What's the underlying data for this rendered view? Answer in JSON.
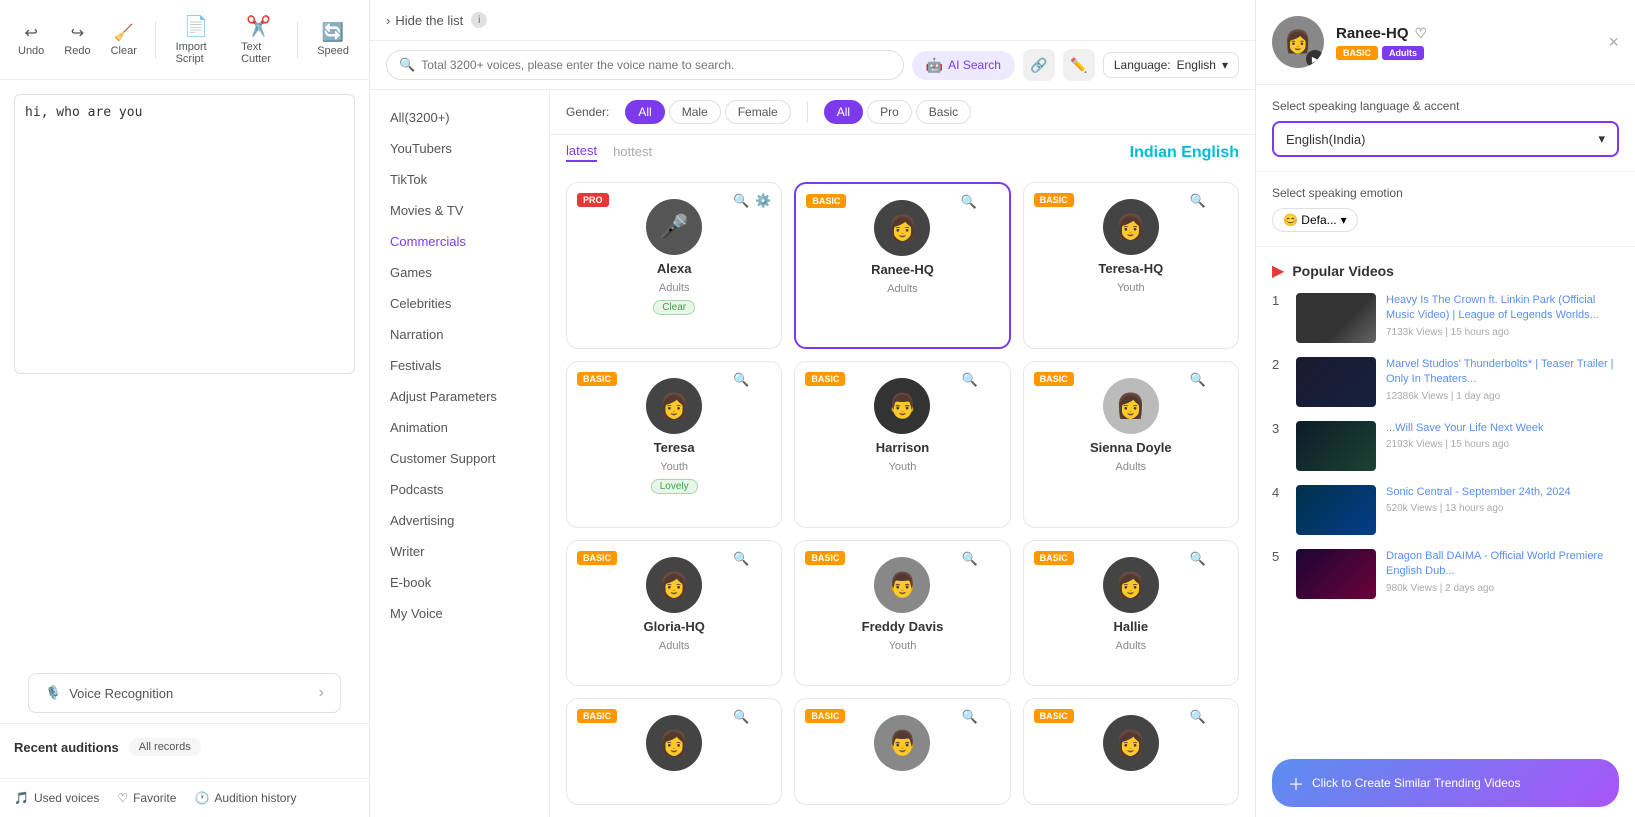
{
  "toolbar": {
    "undo_label": "Undo",
    "redo_label": "Redo",
    "clear_label": "Clear",
    "import_label": "Import Script",
    "text_cutter_label": "Text Cutter",
    "speed_label": "Speed"
  },
  "text_area": {
    "content": "hi, who are you"
  },
  "voice_recognition": {
    "label": "Voice Recognition"
  },
  "recent": {
    "title": "Recent auditions",
    "all_records": "All records"
  },
  "bottom_nav": {
    "used_voices": "Used voices",
    "favorite": "Favorite",
    "audition_history": "Audition history"
  },
  "center": {
    "hide_list": "Hide the list",
    "search_placeholder": "Total 3200+ voices, please enter the voice name to search.",
    "ai_search": "AI Search",
    "language_label": "Language:",
    "language_value": "English",
    "categories": [
      {
        "id": "all",
        "label": "All(3200+)"
      },
      {
        "id": "youtubers",
        "label": "YouTubers"
      },
      {
        "id": "tiktok",
        "label": "TikTok"
      },
      {
        "id": "movies-tv",
        "label": "Movies & TV"
      },
      {
        "id": "commercials",
        "label": "Commercials",
        "active": true
      },
      {
        "id": "games",
        "label": "Games"
      },
      {
        "id": "celebrities",
        "label": "Celebrities"
      },
      {
        "id": "narration",
        "label": "Narration"
      },
      {
        "id": "festivals",
        "label": "Festivals"
      },
      {
        "id": "adjust-params",
        "label": "Adjust Parameters"
      },
      {
        "id": "animation",
        "label": "Animation"
      },
      {
        "id": "customer-support",
        "label": "Customer Support"
      },
      {
        "id": "podcasts",
        "label": "Podcasts"
      },
      {
        "id": "advertising",
        "label": "Advertising"
      },
      {
        "id": "writer",
        "label": "Writer"
      },
      {
        "id": "e-book",
        "label": "E-book"
      },
      {
        "id": "my-voice",
        "label": "My Voice"
      }
    ],
    "gender_label": "Gender:",
    "gender_filters": [
      {
        "id": "all",
        "label": "All",
        "active": true
      },
      {
        "id": "male",
        "label": "Male"
      },
      {
        "id": "female",
        "label": "Female"
      }
    ],
    "quality_filters": [
      {
        "id": "all",
        "label": "All",
        "active": true
      },
      {
        "id": "pro",
        "label": "Pro"
      },
      {
        "id": "basic",
        "label": "Basic"
      }
    ],
    "tabs": [
      {
        "id": "latest",
        "label": "latest",
        "active": true
      },
      {
        "id": "hottest",
        "label": "hottest"
      }
    ],
    "region_title": "Indian English",
    "voices": [
      {
        "id": "alexa",
        "name": "Alexa",
        "type": "Adults",
        "badge": "PRO",
        "badge_type": "pro",
        "tag": "Clear",
        "avatar_class": "mic",
        "avatar_icon": "🎤"
      },
      {
        "id": "ranee-hq",
        "name": "Ranee-HQ",
        "type": "Adults",
        "badge": "BASIC",
        "badge_type": "basic",
        "selected": true,
        "avatar_class": "dark-female",
        "avatar_icon": "👩"
      },
      {
        "id": "teresa-hq",
        "name": "Teresa-HQ",
        "type": "Youth",
        "badge": "BASIC",
        "badge_type": "basic",
        "avatar_class": "dark-female",
        "avatar_icon": "👩"
      },
      {
        "id": "teresa",
        "name": "Teresa",
        "type": "Youth",
        "badge": "BASIC",
        "badge_type": "basic",
        "tag": "Lovely",
        "avatar_class": "dark-female",
        "avatar_icon": "👩"
      },
      {
        "id": "harrison",
        "name": "Harrison",
        "type": "Youth",
        "badge": "BASIC",
        "badge_type": "basic",
        "avatar_class": "dark",
        "avatar_icon": "👨"
      },
      {
        "id": "sienna-doyle",
        "name": "Sienna Doyle",
        "type": "Adults",
        "badge": "BASIC",
        "badge_type": "basic",
        "avatar_class": "gray",
        "avatar_icon": "👩"
      },
      {
        "id": "gloria-hq",
        "name": "Gloria-HQ",
        "type": "Adults",
        "badge": "BASIC",
        "badge_type": "basic",
        "avatar_class": "dark-female",
        "avatar_icon": "👩"
      },
      {
        "id": "freddy-davis",
        "name": "Freddy Davis",
        "type": "Youth",
        "badge": "BASIC",
        "badge_type": "basic",
        "avatar_class": "medium",
        "avatar_icon": "👨"
      },
      {
        "id": "hallie",
        "name": "Hallie",
        "type": "Adults",
        "badge": "BASIC",
        "badge_type": "basic",
        "avatar_class": "dark-female",
        "avatar_icon": "👩"
      },
      {
        "id": "voice-row4-1",
        "name": "",
        "type": "",
        "badge": "BASIC",
        "badge_type": "basic",
        "avatar_class": "dark-female",
        "avatar_icon": "👩"
      },
      {
        "id": "voice-row4-2",
        "name": "",
        "type": "",
        "badge": "BASIC",
        "badge_type": "basic",
        "avatar_class": "medium",
        "avatar_icon": "👨"
      },
      {
        "id": "voice-row4-3",
        "name": "",
        "type": "",
        "badge": "BASIC",
        "badge_type": "basic",
        "avatar_class": "dark-female",
        "avatar_icon": "👩"
      }
    ]
  },
  "right_panel": {
    "selected_name": "Ranee-HQ",
    "badge_basic": "BASIC",
    "badge_adults": "Adults",
    "close_label": "×",
    "language_label": "Select speaking language & accent",
    "language_value": "English(India)",
    "emotion_label": "Select speaking emotion",
    "emotion_default": "😊 Defa...",
    "popular_videos_title": "Popular Videos",
    "videos": [
      {
        "num": "1",
        "title": "Heavy Is The Crown ft. Linkin Park (Official Music Video) | League of Legends Worlds...",
        "meta": "7133k Views | 15 hours ago",
        "thumb_class": "thumb-1"
      },
      {
        "num": "2",
        "title": "Marvel Studios' Thunderbolts* | Teaser Trailer | Only In Theaters...",
        "meta": "12386k Views | 1 day ago",
        "thumb_class": "thumb-2"
      },
      {
        "num": "3",
        "title": "...Will Save Your Life Next Week",
        "meta": "2193k Views | 15 hours ago",
        "thumb_class": "thumb-3"
      },
      {
        "num": "4",
        "title": "Sonic Central - September 24th, 2024",
        "meta": "520k Views | 13 hours ago",
        "thumb_class": "thumb-4"
      },
      {
        "num": "5",
        "title": "Dragon Ball DAIMA - Official World Premiere English Dub...",
        "meta": "980k Views | 2 days ago",
        "thumb_class": "thumb-5"
      }
    ],
    "create_btn": "Click to Create Similar Trending Videos"
  }
}
